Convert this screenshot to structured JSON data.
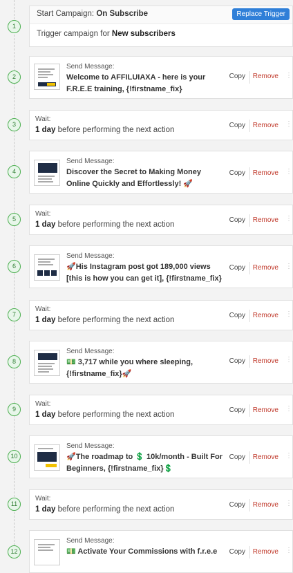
{
  "trigger": {
    "step": "1",
    "start_prefix": "Start Campaign:",
    "start_value": "On Subscribe",
    "replace_label": "Replace Trigger",
    "trigger_prefix": "Trigger campaign for",
    "trigger_value": "New subscribers"
  },
  "actions": {
    "copy": "Copy",
    "remove": "Remove"
  },
  "wait": {
    "label": "Wait:",
    "amount": "1 day",
    "suffix": "before performing the next action"
  },
  "message_label": "Send Message:",
  "steps": [
    {
      "num": "2",
      "title": "Welcome to AFFILUIAXA - here is your F.R.E.E training, {!firstname_fix}"
    },
    {
      "num": "3"
    },
    {
      "num": "4",
      "title": "Discover the Secret to Making Money Online Quickly and Effortlessly! 🚀"
    },
    {
      "num": "5"
    },
    {
      "num": "6",
      "title": "🚀His Instagram post got 189,000 views [this is how you can get it], {!firstname_fix}"
    },
    {
      "num": "7"
    },
    {
      "num": "8",
      "title": "💵 3,717 while you where sleeping, {!firstname_fix}🚀"
    },
    {
      "num": "9"
    },
    {
      "num": "10",
      "title": "🚀The roadmap to 💲 10k/month - Built For Beginners, {!firstname_fix}💲"
    },
    {
      "num": "11"
    },
    {
      "num": "12",
      "title": "💵 Activate Your Commissions with f.r.e.e"
    }
  ]
}
